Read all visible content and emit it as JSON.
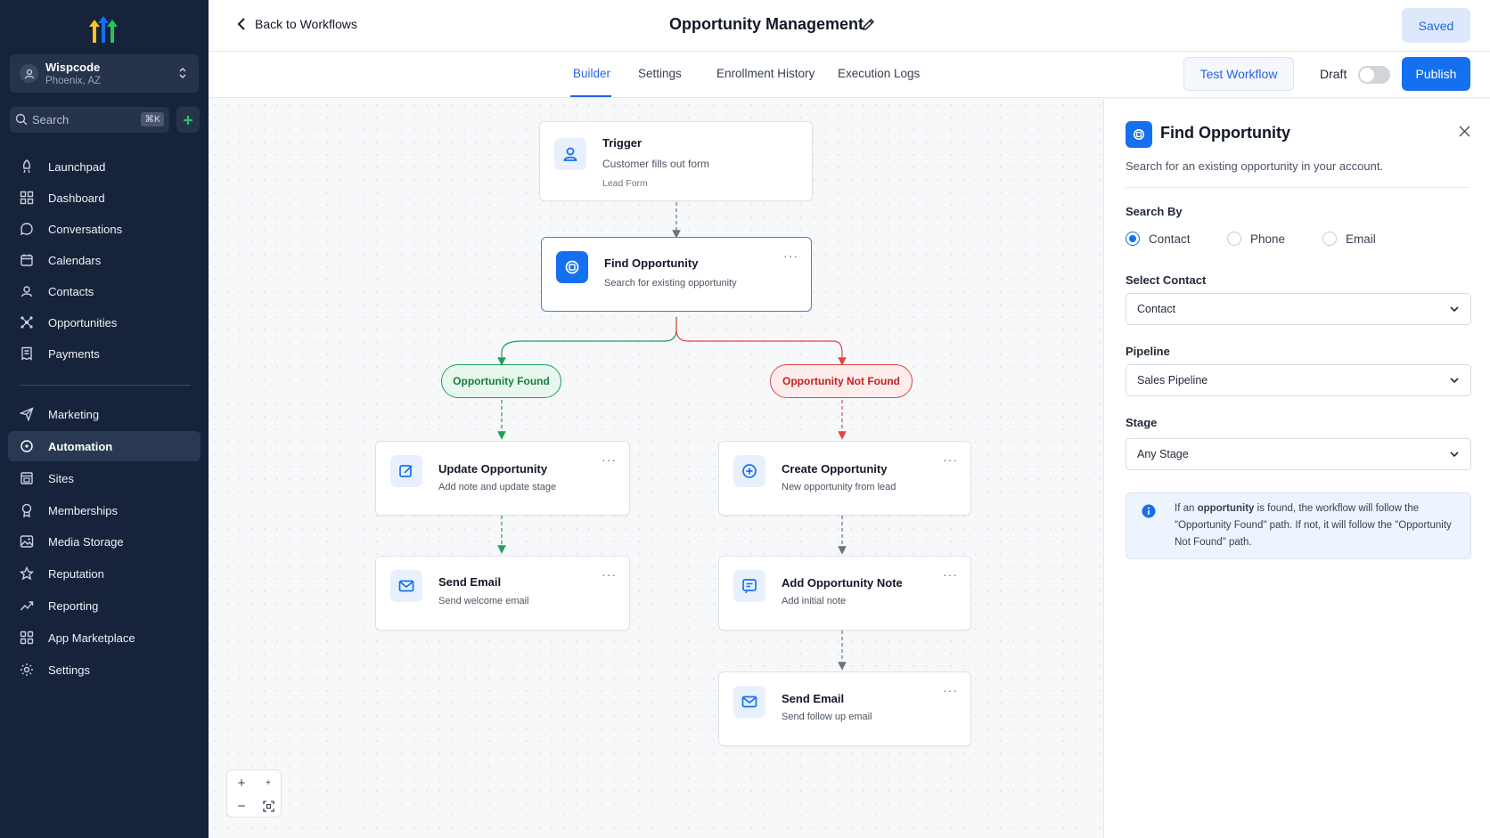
{
  "colors": {
    "sidebar_bg": "#17233a",
    "accent": "#1570ef",
    "found": "#22a05b",
    "not_found": "#e04848"
  },
  "account": {
    "name": "Wispcode",
    "location": "Phoenix, AZ"
  },
  "search": {
    "placeholder": "Search",
    "shortcut": "⌘K"
  },
  "nav": {
    "group1": [
      {
        "label": "Launchpad",
        "icon": "rocket-icon"
      },
      {
        "label": "Dashboard",
        "icon": "grid-icon"
      },
      {
        "label": "Conversations",
        "icon": "chat-icon"
      },
      {
        "label": "Calendars",
        "icon": "calendar-icon"
      },
      {
        "label": "Contacts",
        "icon": "contacts-icon"
      },
      {
        "label": "Opportunities",
        "icon": "network-icon"
      },
      {
        "label": "Payments",
        "icon": "receipt-icon"
      }
    ],
    "group2": [
      {
        "label": "Marketing",
        "icon": "send-icon"
      },
      {
        "label": "Automation",
        "icon": "automation-icon",
        "active": true
      },
      {
        "label": "Sites",
        "icon": "sites-icon"
      },
      {
        "label": "Memberships",
        "icon": "award-icon"
      },
      {
        "label": "Media Storage",
        "icon": "image-icon"
      },
      {
        "label": "Reputation",
        "icon": "star-icon"
      },
      {
        "label": "Reporting",
        "icon": "trend-icon"
      },
      {
        "label": "App Marketplace",
        "icon": "apps-icon"
      },
      {
        "label": "Settings",
        "icon": "gear-icon"
      }
    ]
  },
  "header": {
    "back_label": "Back to Workflows",
    "title": "Opportunity Management",
    "saved_label": "Saved"
  },
  "tabs": [
    "Builder",
    "Settings",
    "Enrollment History",
    "Execution Logs"
  ],
  "toolbar": {
    "test_label": "Test Workflow",
    "draft_label": "Draft",
    "publish_label": "Publish"
  },
  "workflow": {
    "trigger": {
      "title": "Trigger",
      "subtitle": "Customer fills out form",
      "detail": "Lead Form"
    },
    "find": {
      "title": "Find Opportunity",
      "subtitle": "Search for existing opportunity"
    },
    "branch_found": "Opportunity Found",
    "branch_not_found": "Opportunity Not Found",
    "update": {
      "title": "Update Opportunity",
      "subtitle": "Add note and update stage"
    },
    "send_welcome": {
      "title": "Send Email",
      "subtitle": "Send welcome email"
    },
    "create": {
      "title": "Create Opportunity",
      "subtitle": "New opportunity from lead"
    },
    "add_note": {
      "title": "Add Opportunity Note",
      "subtitle": "Add initial note"
    },
    "send_followup": {
      "title": "Send Email",
      "subtitle": "Send follow up email"
    }
  },
  "panel": {
    "title": "Find Opportunity",
    "description": "Search for an existing opportunity in your account.",
    "search_by_label": "Search By",
    "search_by_options": [
      "Contact",
      "Phone",
      "Email"
    ],
    "search_by_selected": "Contact",
    "select_contact_label": "Select Contact",
    "select_contact_value": "Contact",
    "pipeline_label": "Pipeline",
    "pipeline_value": "Sales Pipeline",
    "stage_label": "Stage",
    "stage_value": "Any Stage",
    "info_pre": "If an ",
    "info_bold": "opportunity",
    "info_post": " is found, the workflow will follow the \"Opportunity Found\" path. If not, it will follow the \"Opportunity Not Found\" path."
  }
}
